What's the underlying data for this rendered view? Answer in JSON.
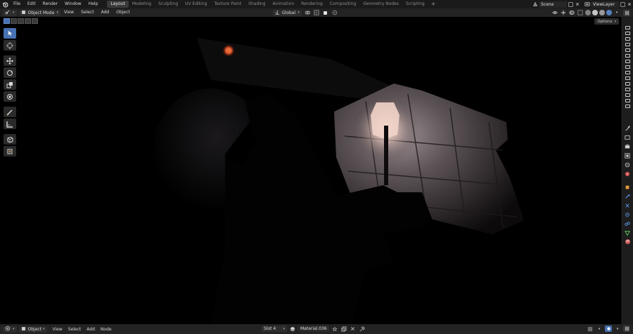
{
  "topbar": {
    "menus": [
      "File",
      "Edit",
      "Render",
      "Window",
      "Help"
    ],
    "workspaces": [
      "Layout",
      "Modeling",
      "Sculpting",
      "UV Editing",
      "Texture Paint",
      "Shading",
      "Animation",
      "Rendering",
      "Compositing",
      "Geometry Nodes",
      "Scripting"
    ],
    "active_workspace": "Layout",
    "add_workspace": "+",
    "scene": "Scene",
    "view_layer": "ViewLayer"
  },
  "viewport_header": {
    "mode": "Object Mode",
    "menus": [
      "View",
      "Select",
      "Add",
      "Object"
    ],
    "transform_orientation": "Global",
    "options": "Options"
  },
  "tools": [
    "select-box",
    "cursor",
    "move",
    "rotate",
    "scale",
    "transform",
    "annotate",
    "measure",
    "add-cube",
    "add-object"
  ],
  "bottom_header": {
    "mode": "Object",
    "menus": [
      "View",
      "Select",
      "Add",
      "Node"
    ],
    "slot": "Slot 4",
    "material": "Material.036"
  },
  "colors": {
    "accent": "#4772b3",
    "header_bg": "#232323",
    "topbar_bg": "#1a1a1a",
    "viewport_bg": "#000000",
    "lamp_glow": "#f3d3c6"
  }
}
